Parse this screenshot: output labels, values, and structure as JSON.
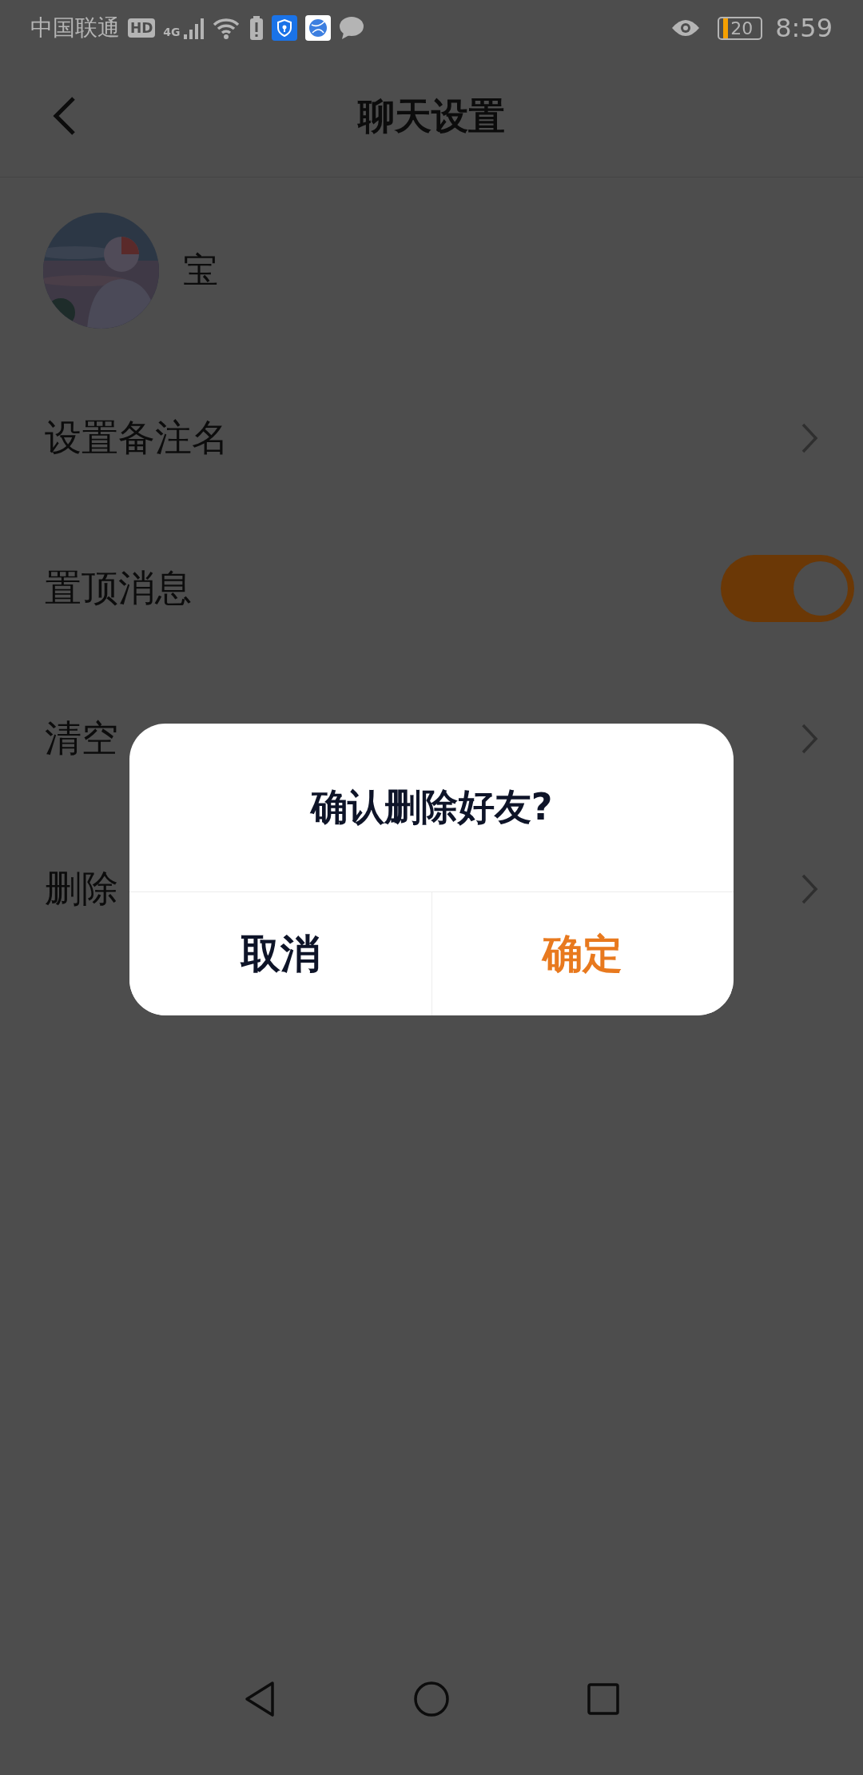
{
  "status_bar": {
    "carrier": "中国联通",
    "hd": "HD",
    "network": "4G",
    "battery": "20",
    "time": "8:59"
  },
  "header": {
    "title": "聊天设置"
  },
  "profile": {
    "name": "宝"
  },
  "rows": [
    {
      "kind": "link",
      "label": "设置备注名"
    },
    {
      "kind": "toggle",
      "label": "置顶消息",
      "on": true
    },
    {
      "kind": "link",
      "label": "清空"
    },
    {
      "kind": "link",
      "label": "删除"
    }
  ],
  "dialog": {
    "title": "确认删除好友?",
    "buttons": [
      {
        "kind": "cancel",
        "label": "取消"
      },
      {
        "kind": "confirm",
        "label": "确定"
      }
    ]
  }
}
